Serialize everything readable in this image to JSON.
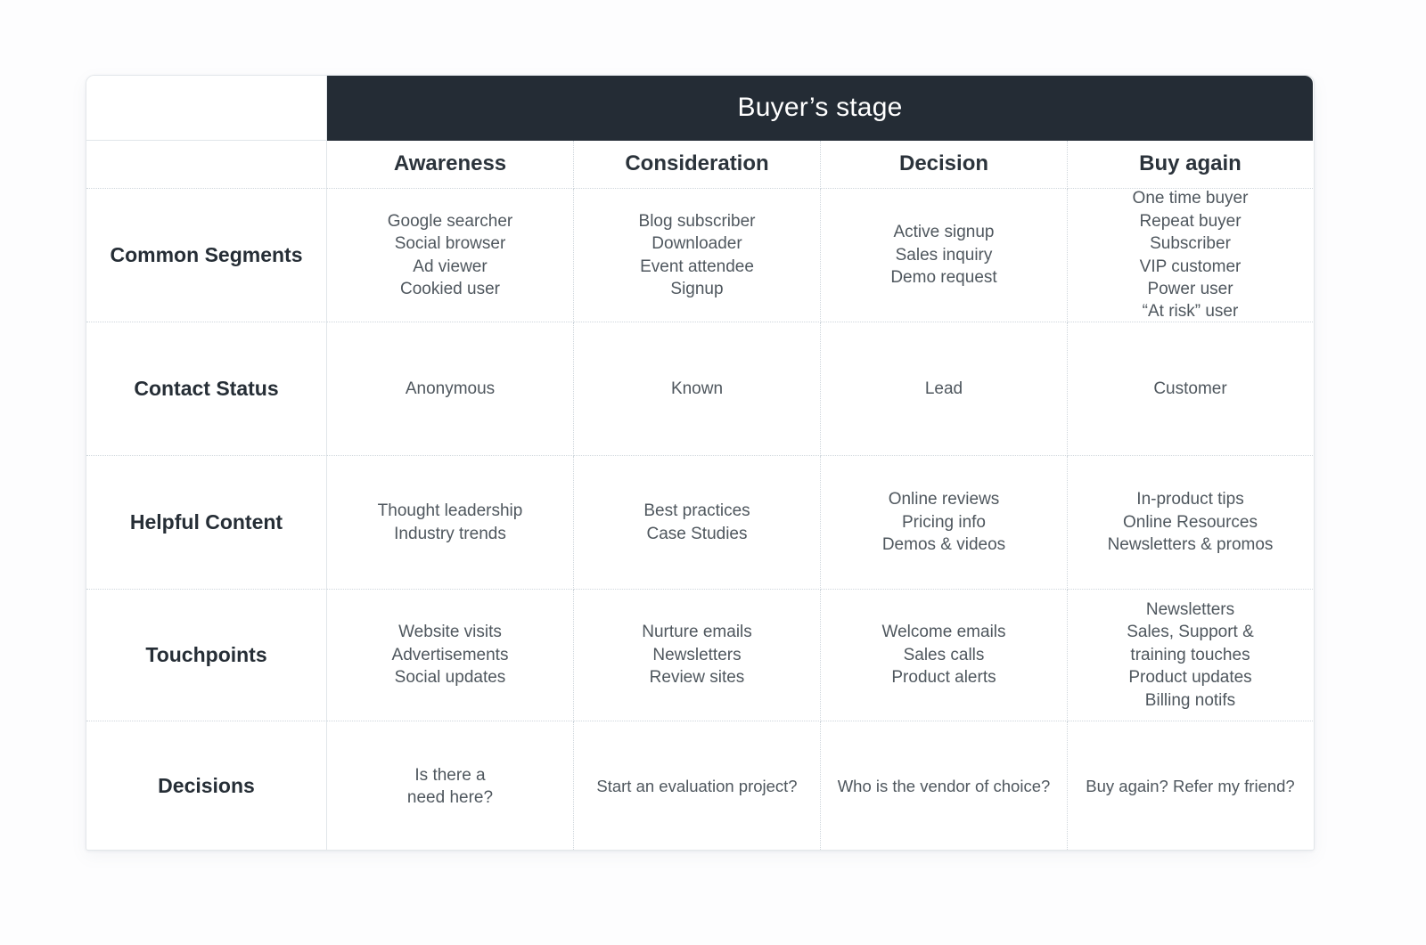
{
  "banner": {
    "title": "Buyer’s stage"
  },
  "colors": {
    "banner_bg": "#242c35",
    "card_bg": "#ffffff",
    "page_bg": "#fdfdfe",
    "grid_line": "#cfd6dc",
    "heading_text": "#2b333b",
    "body_text": "#4f575e"
  },
  "corner_label": "",
  "stages": [
    {
      "label": "Awareness"
    },
    {
      "label": "Consideration"
    },
    {
      "label": "Decision"
    },
    {
      "label": "Buy again"
    }
  ],
  "rows": [
    {
      "label_line1": "Common",
      "label_line2": "Segments",
      "cells": [
        [
          "Google searcher",
          "Social browser",
          "Ad viewer",
          "Cookied user"
        ],
        [
          "Blog subscriber",
          "Downloader",
          "Event attendee",
          "Signup"
        ],
        [
          "Active signup",
          "Sales inquiry",
          "Demo request"
        ],
        [
          "One time buyer",
          "Repeat buyer",
          "Subscriber",
          "VIP customer",
          "Power user",
          "“At risk” user"
        ]
      ]
    },
    {
      "label_line1": "Contact Status",
      "label_line2": "",
      "cells": [
        [
          "Anonymous"
        ],
        [
          "Known"
        ],
        [
          "Lead"
        ],
        [
          "Customer"
        ]
      ]
    },
    {
      "label_line1": "Helpful Content",
      "label_line2": "",
      "cells": [
        [
          "Thought leadership",
          "Industry trends"
        ],
        [
          "Best practices",
          "Case Studies"
        ],
        [
          "Online reviews",
          "Pricing info",
          "Demos & videos"
        ],
        [
          "In-product tips",
          "Online Resources",
          "Newsletters & promos"
        ]
      ]
    },
    {
      "label_line1": "Touchpoints",
      "label_line2": "",
      "cells": [
        [
          "Website visits",
          "Advertisements",
          "Social updates"
        ],
        [
          "Nurture emails",
          "Newsletters",
          "Review sites"
        ],
        [
          "Welcome emails",
          "Sales calls",
          "Product alerts"
        ],
        [
          "Newsletters",
          "Sales, Support &",
          "training touches",
          "Product updates",
          "Billing notifs"
        ]
      ]
    },
    {
      "label_line1": "Decisions",
      "label_line2": "",
      "cells": [
        [
          "Is there a",
          "need here?"
        ],
        [
          "Start an evaluation project?"
        ],
        [
          "Who is the vendor of choice?"
        ],
        [
          "Buy again? Refer my friend?"
        ]
      ]
    }
  ]
}
